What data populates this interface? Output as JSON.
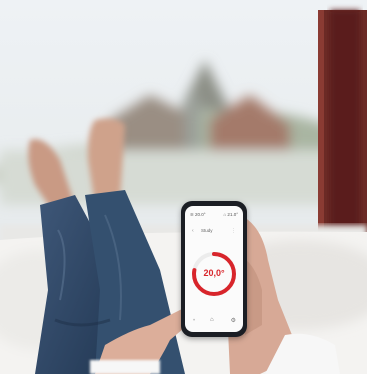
{
  "phone_app": {
    "status_left": "≋ 20.0°",
    "status_right": "⌂ 21.0°",
    "back_icon": "‹",
    "room_name": "Study",
    "more_icon": "⋮",
    "temperature": "20,0°",
    "dial_level": 0.78,
    "accent_color": "#d8252b",
    "nav": {
      "dot": "•",
      "home_icon": "⌂",
      "settings_icon": "⚙"
    }
  }
}
